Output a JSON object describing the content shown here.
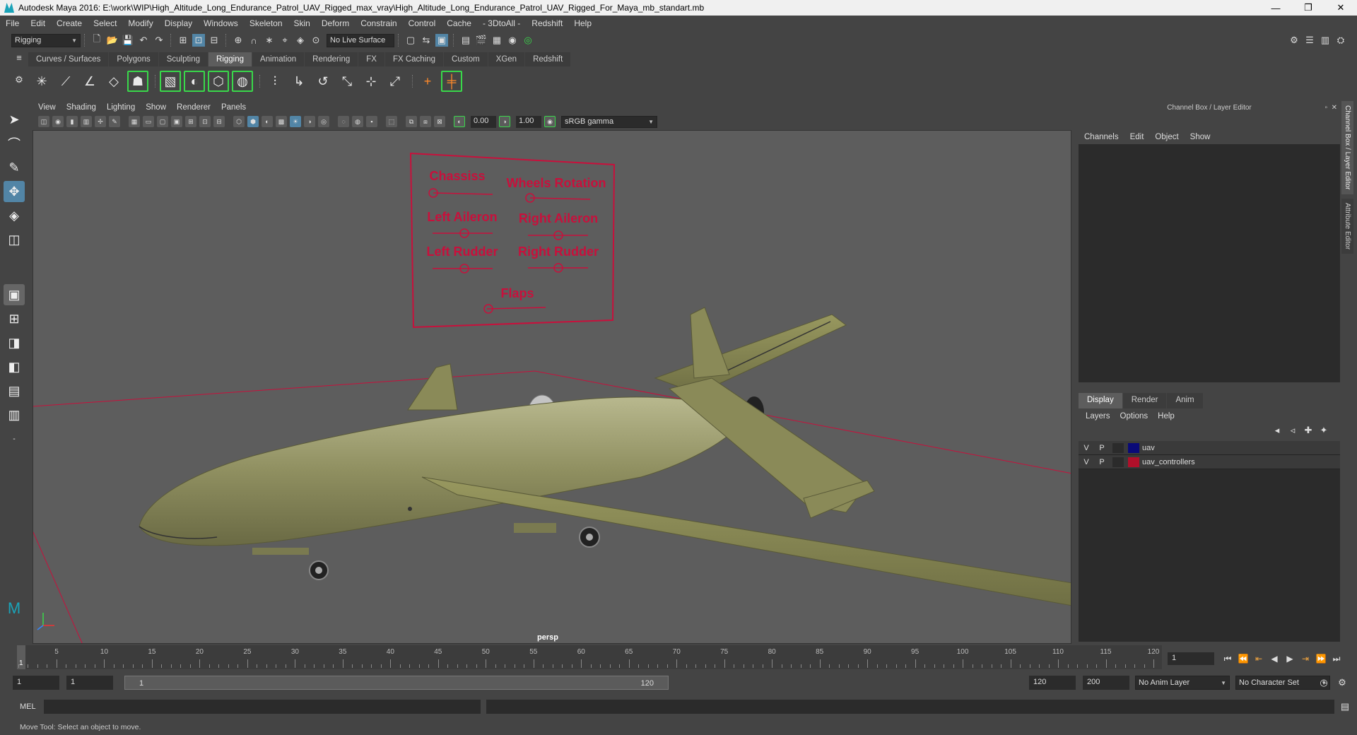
{
  "window": {
    "title": "Autodesk Maya 2016: E:\\work\\WIP\\High_Altitude_Long_Endurance_Patrol_UAV_Rigged_max_vray\\High_Altitude_Long_Endurance_Patrol_UAV_Rigged_For_Maya_mb_standart.mb",
    "minimize": "—",
    "restore": "❐",
    "close": "✕"
  },
  "menubar": [
    "File",
    "Edit",
    "Create",
    "Select",
    "Modify",
    "Display",
    "Windows",
    "Skeleton",
    "Skin",
    "Deform",
    "Constrain",
    "Control",
    "Cache",
    "- 3DtoAll -",
    "Redshift",
    "Help"
  ],
  "statusline": {
    "menuset": "Rigging",
    "live_surface": "No Live Surface"
  },
  "shelf": {
    "tabs": [
      "Curves / Surfaces",
      "Polygons",
      "Sculpting",
      "Rigging",
      "Animation",
      "Rendering",
      "FX",
      "FX Caching",
      "Custom",
      "XGen",
      "Redshift"
    ],
    "active_tab": "Rigging"
  },
  "viewport": {
    "menu": [
      "View",
      "Shading",
      "Lighting",
      "Show",
      "Renderer",
      "Panels"
    ],
    "near_value": "0.00",
    "far_value": "1.00",
    "color_space": "sRGB gamma",
    "camera_label": "persp"
  },
  "controller_board": {
    "border_color": "#c8103c",
    "labels": {
      "chassis": "Chassiss",
      "wheels_rotation": "Wheels Rotation",
      "left_aileron": "Left Aileron",
      "right_aileron": "Right Aileron",
      "left_rudder": "Left Rudder",
      "right_rudder": "Right Rudder",
      "flaps": "Flaps"
    }
  },
  "channel_box": {
    "header": "Channel Box / Layer Editor",
    "menu": [
      "Channels",
      "Edit",
      "Object",
      "Show"
    ]
  },
  "layer_editor": {
    "tabs": [
      "Display",
      "Render",
      "Anim"
    ],
    "active_tab": "Display",
    "menu": [
      "Layers",
      "Options",
      "Help"
    ],
    "layers": [
      {
        "v": "V",
        "p": "P",
        "color": "#0a0a78",
        "name": "uav"
      },
      {
        "v": "V",
        "p": "P",
        "color": "#b0102a",
        "name": "uav_controllers"
      }
    ]
  },
  "side_tabs": [
    "Channel Box / Layer Editor",
    "Attribute Editor"
  ],
  "timeline": {
    "ticks": [
      "5",
      "10",
      "15",
      "20",
      "25",
      "30",
      "35",
      "40",
      "45",
      "50",
      "55",
      "60",
      "65",
      "70",
      "75",
      "80",
      "85",
      "90",
      "95",
      "100",
      "105",
      "110",
      "115",
      "120"
    ],
    "current_frame": "1",
    "frame_field": "1"
  },
  "range": {
    "start": "1",
    "playback_start": "1",
    "slider_start": "1",
    "slider_end": "120",
    "playback_end": "120",
    "end": "200",
    "anim_layer": "No Anim Layer",
    "character_set": "No Character Set"
  },
  "command_line": {
    "label": "MEL"
  },
  "help_line": "Move Tool: Select an object to move.",
  "colors": {
    "accent": "#5285a6",
    "shelf_highlight": "#39d84a",
    "viewport_bg": "#5d5d5d",
    "grid_line": "#c8103c",
    "uav_body": "#8a8a5a"
  }
}
